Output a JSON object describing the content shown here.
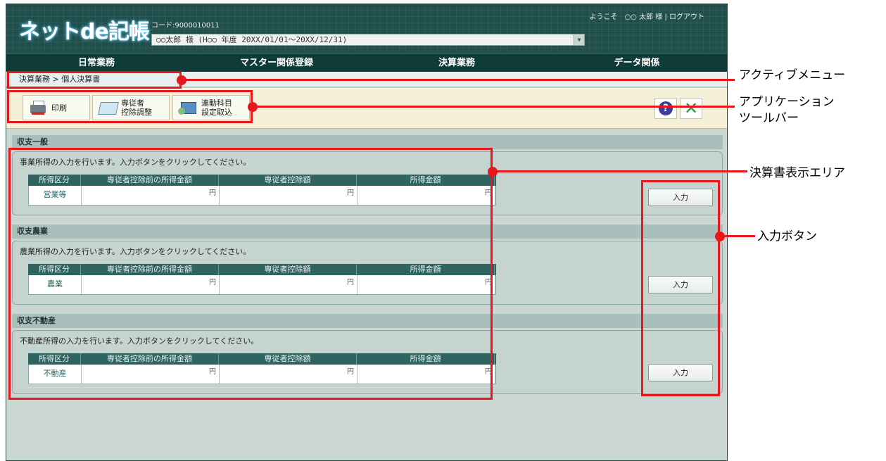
{
  "header": {
    "logo_main": "ネットde記帳",
    "code_label": "コード:9000010011",
    "user_period": "○○太郎 様 (H○○ 年度 20XX/01/01～20XX/12/31)",
    "greeting": "ようこそ　○○ 太郎 様 | ログアウト"
  },
  "nav": [
    "日常業務",
    "マスター関係登録",
    "決算業務",
    "データ関係"
  ],
  "breadcrumb": "決算業務 > 個人決算書",
  "toolbar": {
    "print": "印刷",
    "deduct_line1": "専従者",
    "deduct_line2": "控除調整",
    "import_line1": "連動科目",
    "import_line2": "設定取込",
    "help": "?",
    "close": "✕"
  },
  "grid_headers": [
    "所得区分",
    "専従者控除前の所得金額",
    "専従者控除額",
    "所得金額"
  ],
  "yen": "円",
  "sections": [
    {
      "title": "収支一般",
      "desc": "事業所得の入力を行います。入力ボタンをクリックしてください。",
      "category": "営業等",
      "button": "入力"
    },
    {
      "title": "収支農業",
      "desc": "農業所得の入力を行います。入力ボタンをクリックしてください。",
      "category": "農業",
      "button": "入力"
    },
    {
      "title": "収支不動産",
      "desc": "不動産所得の入力を行います。入力ボタンをクリックしてください。",
      "category": "不動産",
      "button": "入力"
    }
  ],
  "annotations": {
    "active_menu": "アクティブメニュー",
    "app_toolbar_1": "アプリケーション",
    "app_toolbar_2": "ツールバー",
    "display_area": "決算書表示エリア",
    "input_button": "入力ボタン"
  },
  "colors": {
    "header_bg": "#214f4c",
    "nav_bg": "#0f3b39",
    "annotation_red": "#e8171b"
  }
}
